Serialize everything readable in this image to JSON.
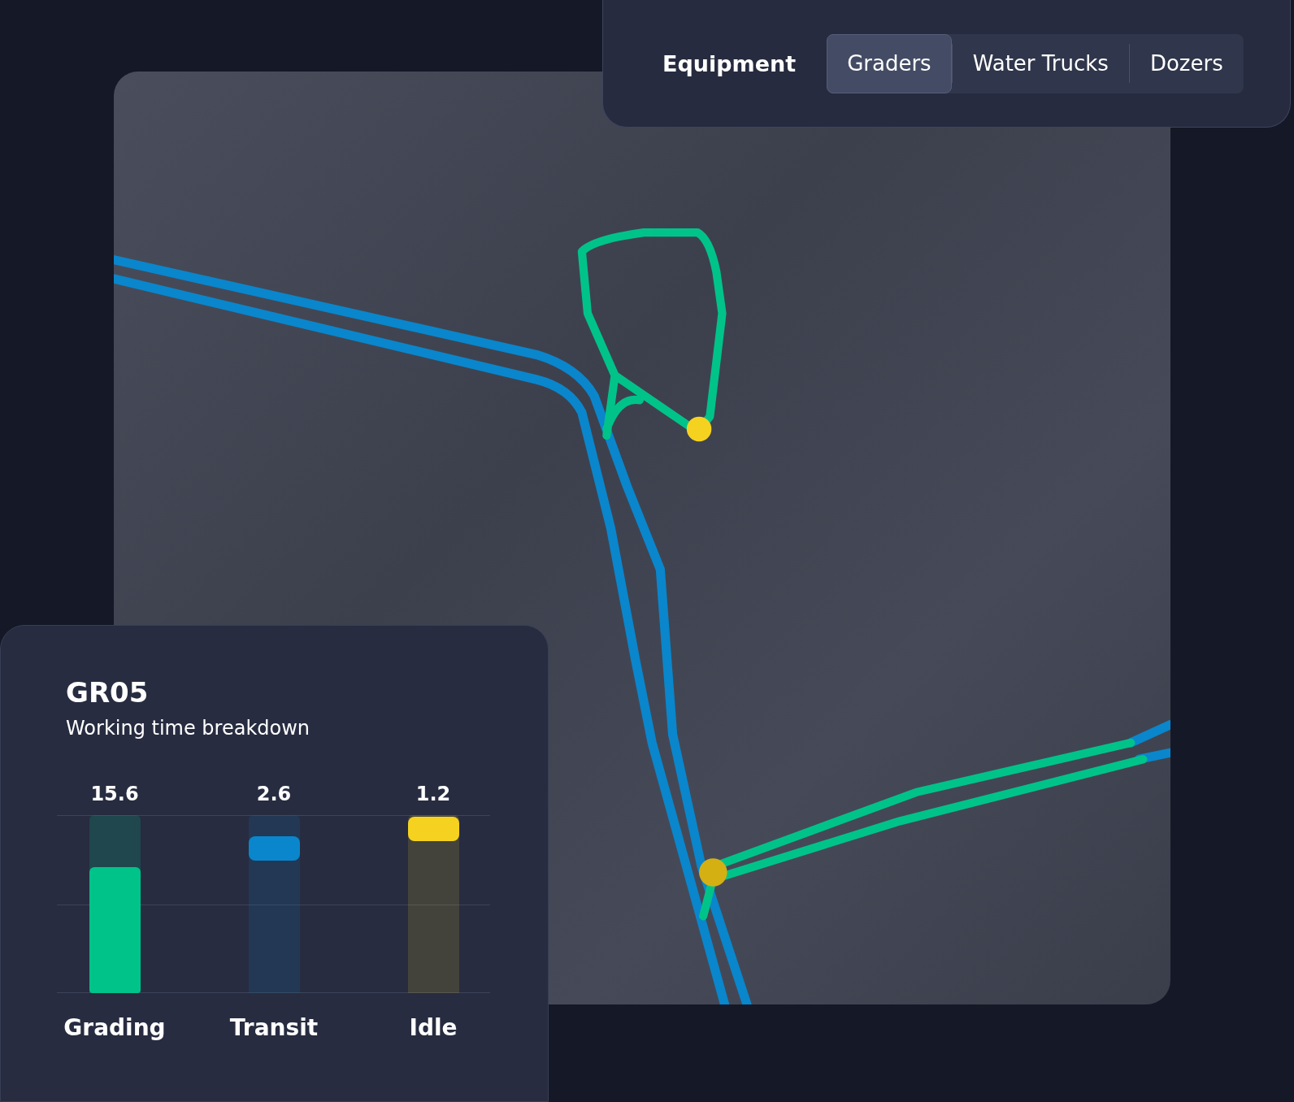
{
  "equipment_panel": {
    "label": "Equipment",
    "tabs": [
      {
        "label": "Graders",
        "selected": true
      },
      {
        "label": "Water Trucks",
        "selected": false
      },
      {
        "label": "Dozers",
        "selected": false
      }
    ]
  },
  "detail_card": {
    "title": "GR05",
    "subtitle": "Working time breakdown",
    "bars": [
      {
        "label": "Grading",
        "value": "15.6",
        "kind": "fill",
        "level": 0.71,
        "color": "#00c389"
      },
      {
        "label": "Transit",
        "value": "2.6",
        "kind": "marker",
        "level": 0.88,
        "color": "#0a86cc"
      },
      {
        "label": "Idle",
        "value": "1.2",
        "kind": "marker",
        "level": 0.99,
        "color": "#f5d21f"
      }
    ]
  }
}
